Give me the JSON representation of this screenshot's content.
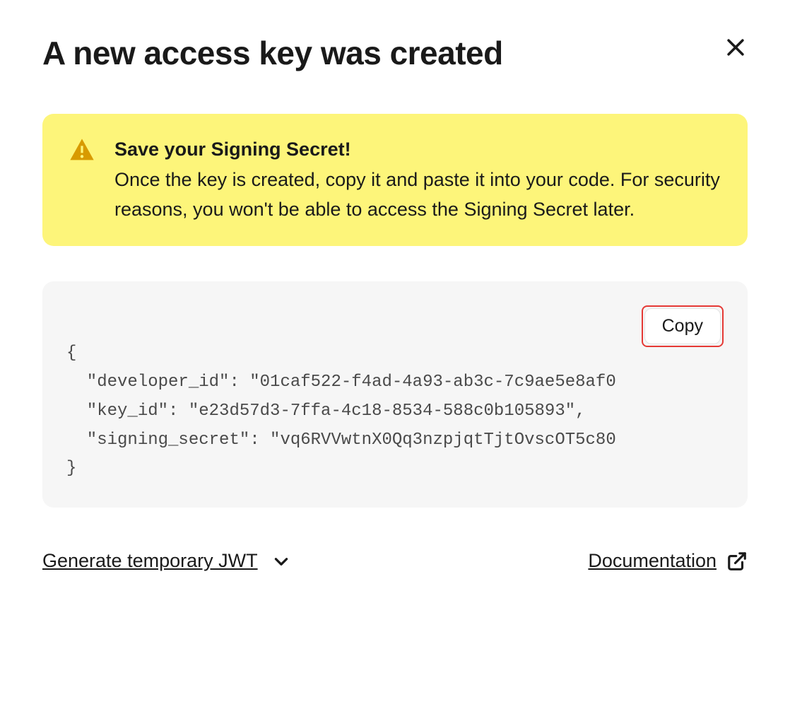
{
  "modal": {
    "title": "A new access key was created"
  },
  "alert": {
    "title": "Save your Signing Secret!",
    "body": "Once the key is created, copy it and paste it into your code. For security reasons, you won't be able to access the Signing Secret later."
  },
  "codeblock": {
    "copy_label": "Copy",
    "content": "{\n  \"developer_id\": \"01caf522-f4ad-4a93-ab3c-7c9ae5e8af0\n  \"key_id\": \"e23d57d3-7ffa-4c18-8534-588c0b105893\",\n  \"signing_secret\": \"vq6RVVwtnX0Qq3nzpjqtTjtOvscOT5c80\n}"
  },
  "footer": {
    "jwt_label": "Generate temporary JWT",
    "docs_label": "Documentation"
  }
}
